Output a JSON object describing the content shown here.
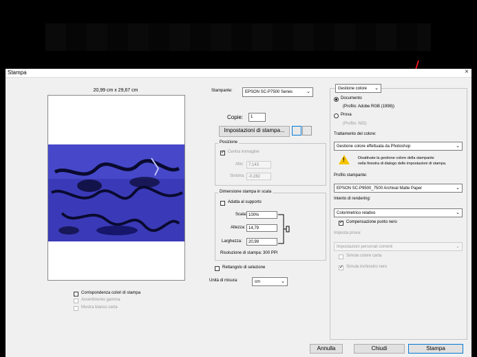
{
  "dialog": {
    "title": "Stampa",
    "close": "×"
  },
  "preview": {
    "dimensions": "20,99 cm x 29,67 cm",
    "match_colors_label": "Corrispondenza colori di stampa",
    "gamut_warning_label": "Avvertimento gamma",
    "show_paper_white_label": "Mostra bianco carta"
  },
  "printer": {
    "label": "Stampante:",
    "value": "EPSON SC-P7500 Series",
    "copies_label": "Copie:",
    "copies_value": "1",
    "settings_button": "Impostazioni di stampa..."
  },
  "position": {
    "legend": "Posizione",
    "center_label": "Centra immagine",
    "top_label": "Alto:",
    "top_value": "7,143",
    "left_label": "Sinistra:",
    "left_value": "-0,282"
  },
  "scaled_size": {
    "legend": "Dimensione stampa in scala",
    "fit_label": "Adatta al supporto",
    "scale_label": "Scala:",
    "scale_value": "100%",
    "height_label": "Altezza:",
    "height_value": "14,79",
    "width_label": "Larghezza:",
    "width_value": "20,99",
    "resolution": "Risoluzione di stampa: 300 PPI"
  },
  "bounding_box_label": "Rettangolo di selezione",
  "units": {
    "label": "Unità di misura:",
    "value": "cm"
  },
  "color": {
    "header": "Gestione colore",
    "document_label": "Documento",
    "document_profile": "(Profilo: Adobe RGB (1998))",
    "proof_label": "Prova",
    "proof_profile": "(Profilo: N/D)",
    "handling_label": "Trattamento del colore:",
    "handling_value": "Gestione colore effettuata da Photoshop",
    "warning_text_1": "Disattivate la gestione colore della stampante",
    "warning_text_2": "nella finestra di dialogo delle impostazioni di stampa.",
    "printer_profile_label": "Profilo stampante:",
    "printer_profile_value": "EPSON SC-P9500_7500 Archival Matte Paper",
    "intent_label": "Intento di rendering:",
    "intent_value": "Colorimetrico relativo",
    "bpc_label": "Compensazione punto nero",
    "proof_setup_label": "Imposta prova:",
    "proof_setup_value": "Impostazioni personali correnti",
    "sim_paper_label": "Simula colore carta",
    "sim_ink_label": "Simula inchiostro nero"
  },
  "buttons": {
    "cancel": "Annulla",
    "close": "Chiudi",
    "print": "Stampa"
  },
  "colors": {
    "arrow": "#e8141c",
    "accent": "#0078d7"
  }
}
